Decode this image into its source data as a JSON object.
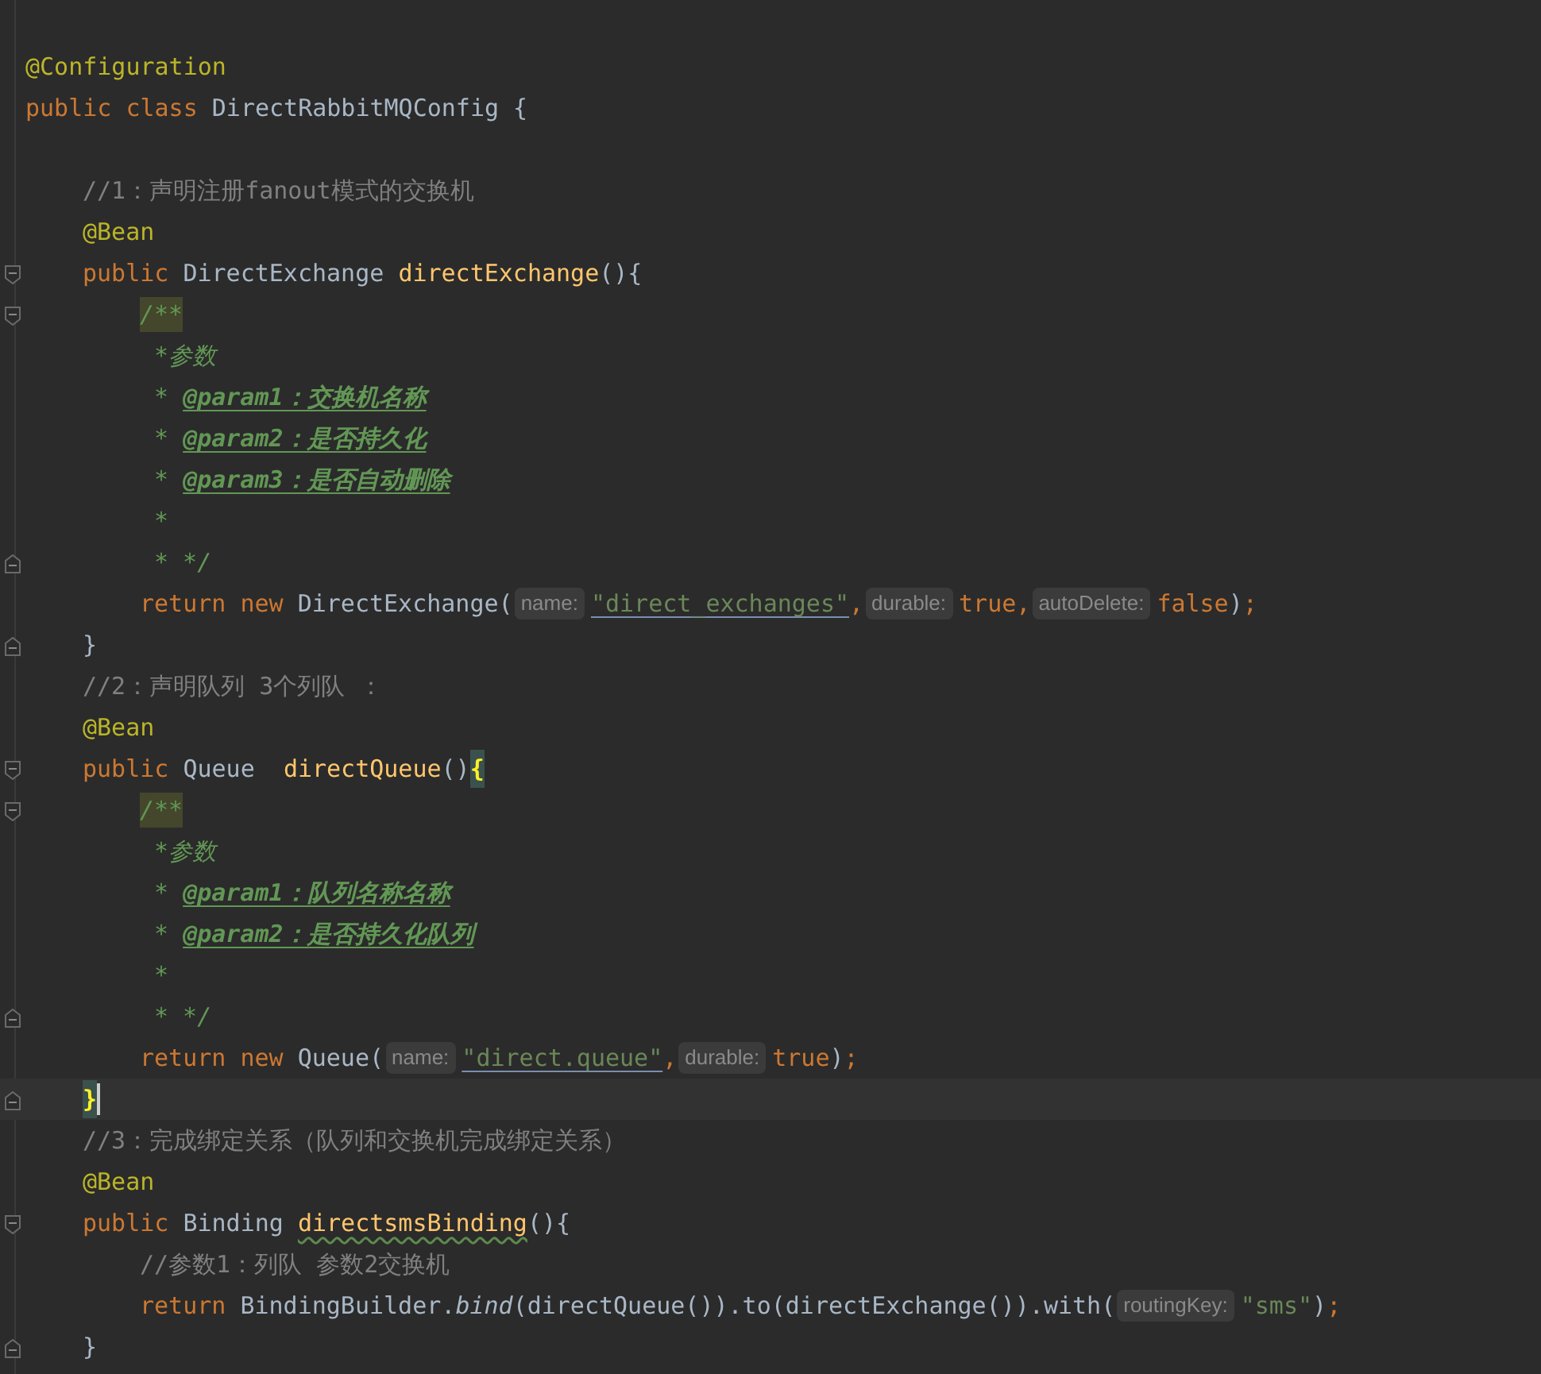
{
  "editor": {
    "lines": [
      {
        "tokens": [
          {
            "kind": "annotation",
            "text": "@Configuration"
          }
        ]
      },
      {
        "tokens": [
          {
            "kind": "keyword",
            "text": "public class "
          },
          {
            "kind": "plain",
            "text": "DirectRabbitMQConfig {"
          }
        ],
        "children": [
          {
            "tokens": [
              {
                "kind": "comment",
                "text": "//1：声明注册fanout模式的交换机"
              }
            ]
          },
          {
            "tokens": [
              {
                "kind": "annotation",
                "text": "@Bean"
              }
            ]
          },
          {
            "expanded": true,
            "tokens": [
              {
                "kind": "keyword",
                "text": "public "
              },
              {
                "kind": "plain",
                "text": "DirectExchange "
              },
              {
                "kind": "method",
                "text": "directExchange"
              },
              {
                "kind": "plain",
                "text": "(){"
              }
            ],
            "children": [
              {
                "expanded": true,
                "tokens": [
                  {
                    "kind": "doc-open",
                    "text": "/**"
                  }
                ]
              },
              {
                "tokens": [
                  {
                    "kind": "doc",
                    "text": "*参数"
                  }
                ]
              },
              {
                "tokens": [
                  {
                    "kind": "doc",
                    "text": "* "
                  },
                  {
                    "kind": "doc-tag",
                    "text": "@param1：交换机名称"
                  }
                ]
              },
              {
                "tokens": [
                  {
                    "kind": "doc",
                    "text": "* "
                  },
                  {
                    "kind": "doc-tag",
                    "text": "@param2：是否持久化"
                  }
                ]
              },
              {
                "tokens": [
                  {
                    "kind": "doc",
                    "text": "* "
                  },
                  {
                    "kind": "doc-tag",
                    "text": "@param3：是否自动删除"
                  }
                ]
              },
              {
                "tokens": [
                  {
                    "kind": "doc",
                    "text": "*"
                  }
                ]
              },
              {
                "block_end": true,
                "tokens": [
                  {
                    "kind": "doc",
                    "text": "* */"
                  }
                ]
              },
              {
                "tokens": [
                  {
                    "kind": "keyword",
                    "text": "return new "
                  },
                  {
                    "kind": "plain",
                    "text": "DirectExchange("
                  },
                  {
                    "kind": "hint",
                    "text": "name:"
                  },
                  {
                    "kind": "string-link",
                    "text": "\"direct_exchanges\""
                  },
                  {
                    "kind": "keyword",
                    "text": ","
                  },
                  {
                    "kind": "hint",
                    "text": "durable:"
                  },
                  {
                    "kind": "keyword",
                    "text": "true,"
                  },
                  {
                    "kind": "hint",
                    "text": "autoDelete:"
                  },
                  {
                    "kind": "keyword",
                    "text": "false"
                  },
                  {
                    "kind": "plain",
                    "text": ")"
                  },
                  {
                    "kind": "keyword",
                    "text": ";"
                  }
                ]
              }
            ]
          },
          {
            "block_end": true,
            "tokens": [
              {
                "kind": "plain",
                "text": "}"
              }
            ]
          },
          {
            "tokens": [
              {
                "kind": "comment",
                "text": "//2：声明队列 3个列队 ："
              }
            ]
          },
          {
            "tokens": [
              {
                "kind": "annotation",
                "text": "@Bean"
              }
            ]
          },
          {
            "expanded": true,
            "tokens": [
              {
                "kind": "keyword",
                "text": "public "
              },
              {
                "kind": "plain",
                "text": "Queue  "
              },
              {
                "kind": "method",
                "text": "directQueue"
              },
              {
                "kind": "plain",
                "text": "()"
              },
              {
                "kind": "brace-match",
                "text": "{"
              }
            ],
            "children": [
              {
                "expanded": true,
                "tokens": [
                  {
                    "kind": "doc-open",
                    "text": "/**"
                  }
                ]
              },
              {
                "tokens": [
                  {
                    "kind": "doc",
                    "text": "*参数"
                  }
                ]
              },
              {
                "tokens": [
                  {
                    "kind": "doc",
                    "text": "* "
                  },
                  {
                    "kind": "doc-tag",
                    "text": "@param1：队列名称名称"
                  }
                ]
              },
              {
                "tokens": [
                  {
                    "kind": "doc",
                    "text": "* "
                  },
                  {
                    "kind": "doc-tag",
                    "text": "@param2：是否持久化队列"
                  }
                ]
              },
              {
                "tokens": [
                  {
                    "kind": "doc",
                    "text": "*"
                  }
                ]
              },
              {
                "block_end": true,
                "tokens": [
                  {
                    "kind": "doc",
                    "text": "* */"
                  }
                ]
              },
              {
                "tokens": [
                  {
                    "kind": "keyword",
                    "text": "return new "
                  },
                  {
                    "kind": "plain",
                    "text": "Queue("
                  },
                  {
                    "kind": "hint",
                    "text": "name:"
                  },
                  {
                    "kind": "string-link",
                    "text": "\"direct.queue\""
                  },
                  {
                    "kind": "keyword",
                    "text": ","
                  },
                  {
                    "kind": "hint",
                    "text": "durable:"
                  },
                  {
                    "kind": "keyword",
                    "text": "true"
                  },
                  {
                    "kind": "plain",
                    "text": ")"
                  },
                  {
                    "kind": "keyword",
                    "text": ";"
                  }
                ]
              }
            ]
          },
          {
            "block_end": true,
            "current": true,
            "tokens": [
              {
                "kind": "brace-match",
                "text": "}"
              }
            ]
          },
          {
            "tokens": [
              {
                "kind": "comment",
                "text": "//3：完成绑定关系（队列和交换机完成绑定关系）"
              }
            ]
          },
          {
            "tokens": [
              {
                "kind": "annotation",
                "text": "@Bean"
              }
            ]
          },
          {
            "expanded": true,
            "tokens": [
              {
                "kind": "keyword",
                "text": "public "
              },
              {
                "kind": "plain",
                "text": "Binding "
              },
              {
                "kind": "method-typo",
                "text": "directsmsBinding"
              },
              {
                "kind": "plain",
                "text": "(){"
              }
            ],
            "children": [
              {
                "tokens": [
                  {
                    "kind": "comment",
                    "text": "//参数1：列队 参数2交换机"
                  }
                ]
              },
              {
                "tokens": [
                  {
                    "kind": "keyword",
                    "text": "return "
                  },
                  {
                    "kind": "plain",
                    "text": "BindingBuilder."
                  },
                  {
                    "kind": "static-call",
                    "text": "bind"
                  },
                  {
                    "kind": "plain",
                    "text": "(directQueue()).to(directExchange()).with("
                  },
                  {
                    "kind": "hint",
                    "text": "routingKey:"
                  },
                  {
                    "kind": "string",
                    "text": "\"sms\""
                  },
                  {
                    "kind": "plain",
                    "text": ")"
                  },
                  {
                    "kind": "keyword",
                    "text": ";"
                  }
                ]
              }
            ]
          },
          {
            "block_end": true,
            "tokens": [
              {
                "kind": "plain",
                "text": "}"
              }
            ]
          }
        ]
      }
    ]
  }
}
